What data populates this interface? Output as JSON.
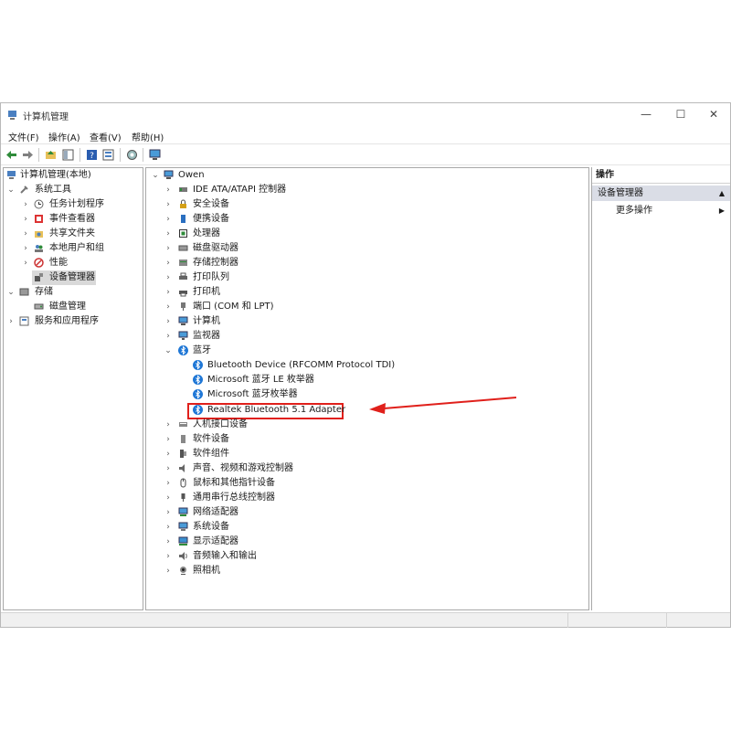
{
  "window": {
    "title": "计算机管理",
    "controls": {
      "minimize": "—",
      "maximize": "☐",
      "close": "✕"
    }
  },
  "menu": [
    "文件(F)",
    "操作(A)",
    "查看(V)",
    "帮助(H)"
  ],
  "left_tree": {
    "root": "计算机管理(本地)",
    "items": [
      {
        "label": "系统工具",
        "expanded": true
      },
      {
        "label": "任务计划程序"
      },
      {
        "label": "事件查看器"
      },
      {
        "label": "共享文件夹"
      },
      {
        "label": "本地用户和组"
      },
      {
        "label": "性能"
      },
      {
        "label": "设备管理器",
        "selected": true
      },
      {
        "label": "存储",
        "expanded": true
      },
      {
        "label": "磁盘管理"
      },
      {
        "label": "服务和应用程序"
      }
    ]
  },
  "device_tree": {
    "root": "Owen",
    "categories": [
      "IDE ATA/ATAPI 控制器",
      "安全设备",
      "便携设备",
      "处理器",
      "磁盘驱动器",
      "存储控制器",
      "打印队列",
      "打印机",
      "端口 (COM 和 LPT)",
      "计算机",
      "监视器",
      "蓝牙"
    ],
    "bluetooth_children": [
      "Bluetooth Device (RFCOMM Protocol TDI)",
      "Microsoft 蓝牙 LE 枚举器",
      "Microsoft 蓝牙枚举器",
      "Realtek Bluetooth 5.1 Adapter"
    ],
    "categories_after": [
      "人机接口设备",
      "软件设备",
      "软件组件",
      "声音、视频和游戏控制器",
      "鼠标和其他指针设备",
      "通用串行总线控制器",
      "网络适配器",
      "系统设备",
      "显示适配器",
      "音频输入和输出",
      "照相机"
    ]
  },
  "actions_pane": {
    "header": "操作",
    "section": "设备管理器",
    "more": "更多操作"
  },
  "colors": {
    "highlight": "#e0201b",
    "selected": "#d9d9d9",
    "bluetooth": "#1f77d6"
  }
}
